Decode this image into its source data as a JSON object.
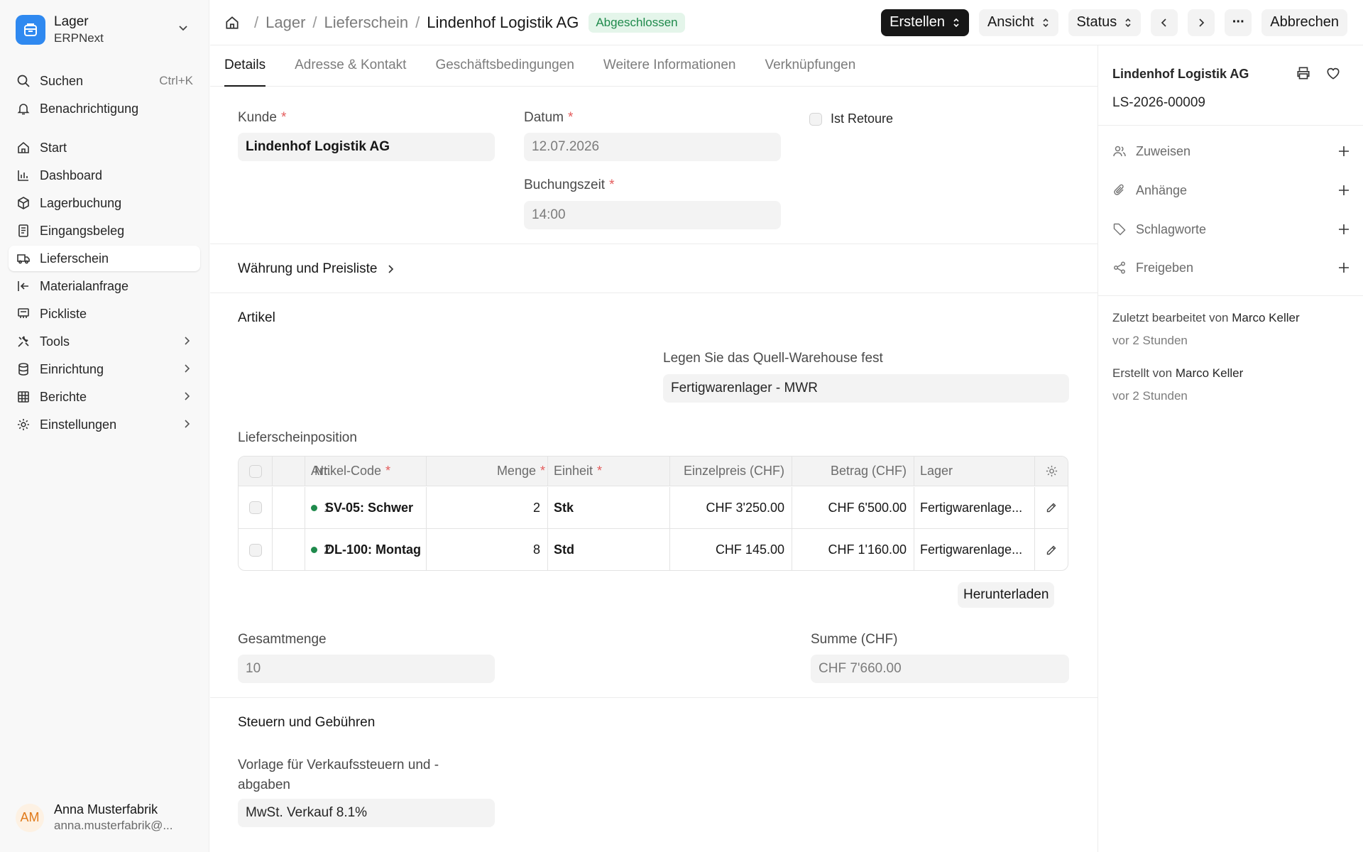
{
  "app": {
    "name": "Lager",
    "subtitle": "ERPNext"
  },
  "sidebar": {
    "search": {
      "label": "Suchen",
      "shortcut": "Ctrl+K"
    },
    "notifications": {
      "label": "Benachrichtigung"
    },
    "items": [
      {
        "label": "Start",
        "icon": "home-icon"
      },
      {
        "label": "Dashboard",
        "icon": "chart-icon"
      },
      {
        "label": "Lagerbuchung",
        "icon": "box-icon"
      },
      {
        "label": "Eingangsbeleg",
        "icon": "receipt-icon"
      },
      {
        "label": "Lieferschein",
        "icon": "truck-icon",
        "active": true
      },
      {
        "label": "Materialanfrage",
        "icon": "arrow-left-bar-icon"
      },
      {
        "label": "Pickliste",
        "icon": "picklist-icon"
      },
      {
        "label": "Tools",
        "icon": "tools-icon",
        "expandable": true
      },
      {
        "label": "Einrichtung",
        "icon": "database-icon",
        "expandable": true
      },
      {
        "label": "Berichte",
        "icon": "table-icon",
        "expandable": true
      },
      {
        "label": "Einstellungen",
        "icon": "gear-icon",
        "expandable": true
      }
    ],
    "user": {
      "initials": "AM",
      "name": "Anna Musterfabrik",
      "email": "anna.musterfabrik@..."
    }
  },
  "header": {
    "breadcrumbs": [
      "Lager",
      "Lieferschein",
      "Lindenhof Logistik AG"
    ],
    "status_badge": "Abgeschlossen",
    "buttons": {
      "create": "Erstellen",
      "view": "Ansicht",
      "status": "Status",
      "more": "···",
      "cancel": "Abbrechen"
    }
  },
  "tabs": [
    "Details",
    "Adresse & Kontakt",
    "Geschäftsbedingungen",
    "Weitere Informationen",
    "Verknüpfungen"
  ],
  "form": {
    "customer": {
      "label": "Kunde",
      "value": "Lindenhof Logistik AG"
    },
    "date": {
      "label": "Datum",
      "value": "12.07.2026"
    },
    "posting_time": {
      "label": "Buchungszeit",
      "value": "14:00"
    },
    "is_return": {
      "label": "Ist Retoure",
      "checked": false
    },
    "currency_section": "Währung und Preisliste",
    "items_section": "Artikel",
    "source_warehouse": {
      "label": "Legen Sie das Quell-Warehouse fest",
      "value": "Fertigwarenlager - MWR"
    },
    "table": {
      "label": "Lieferscheinposition",
      "columns": [
        "Nr.",
        "Artikel-Code",
        "Menge",
        "Einheit",
        "Einzelpreis (CHF)",
        "Betrag (CHF)",
        "Lager"
      ],
      "rows": [
        {
          "no": "1",
          "item": "SV-05: Schwer",
          "qty": "2",
          "uom": "Stk",
          "rate": "CHF 3'250.00",
          "amount": "CHF 6'500.00",
          "warehouse": "Fertigwarenlage..."
        },
        {
          "no": "2",
          "item": "DL-100: Montag",
          "qty": "8",
          "uom": "Std",
          "rate": "CHF 145.00",
          "amount": "CHF 1'160.00",
          "warehouse": "Fertigwarenlage..."
        }
      ],
      "download": "Herunterladen"
    },
    "total_qty": {
      "label": "Gesamtmenge",
      "value": "10"
    },
    "total": {
      "label": "Summe (CHF)",
      "value": "CHF 7'660.00"
    },
    "taxes_section": "Steuern und Gebühren",
    "tax_template": {
      "label_line1": "Vorlage für Verkaufssteuern und -",
      "label_line2": "abgaben",
      "value": "MwSt. Verkauf 8.1%"
    }
  },
  "right_panel": {
    "title": "Lindenhof Logistik AG",
    "doc_id": "LS-2026-00009",
    "actions": [
      {
        "label": "Zuweisen",
        "icon": "users-icon"
      },
      {
        "label": "Anhänge",
        "icon": "paperclip-icon"
      },
      {
        "label": "Schlagworte",
        "icon": "tag-icon"
      },
      {
        "label": "Freigeben",
        "icon": "share-icon"
      }
    ],
    "activity": {
      "edited_prefix": "Zuletzt bearbeitet von",
      "edited_by": "Marco Keller",
      "edited_when": "vor 2 Stunden",
      "created_prefix": "Erstellt von",
      "created_by": "Marco Keller",
      "created_when": "vor 2 Stunden"
    }
  },
  "colors": {
    "accent": "#2f89f0",
    "status_green": "#1f8a4c",
    "required": "#e45b5b"
  }
}
